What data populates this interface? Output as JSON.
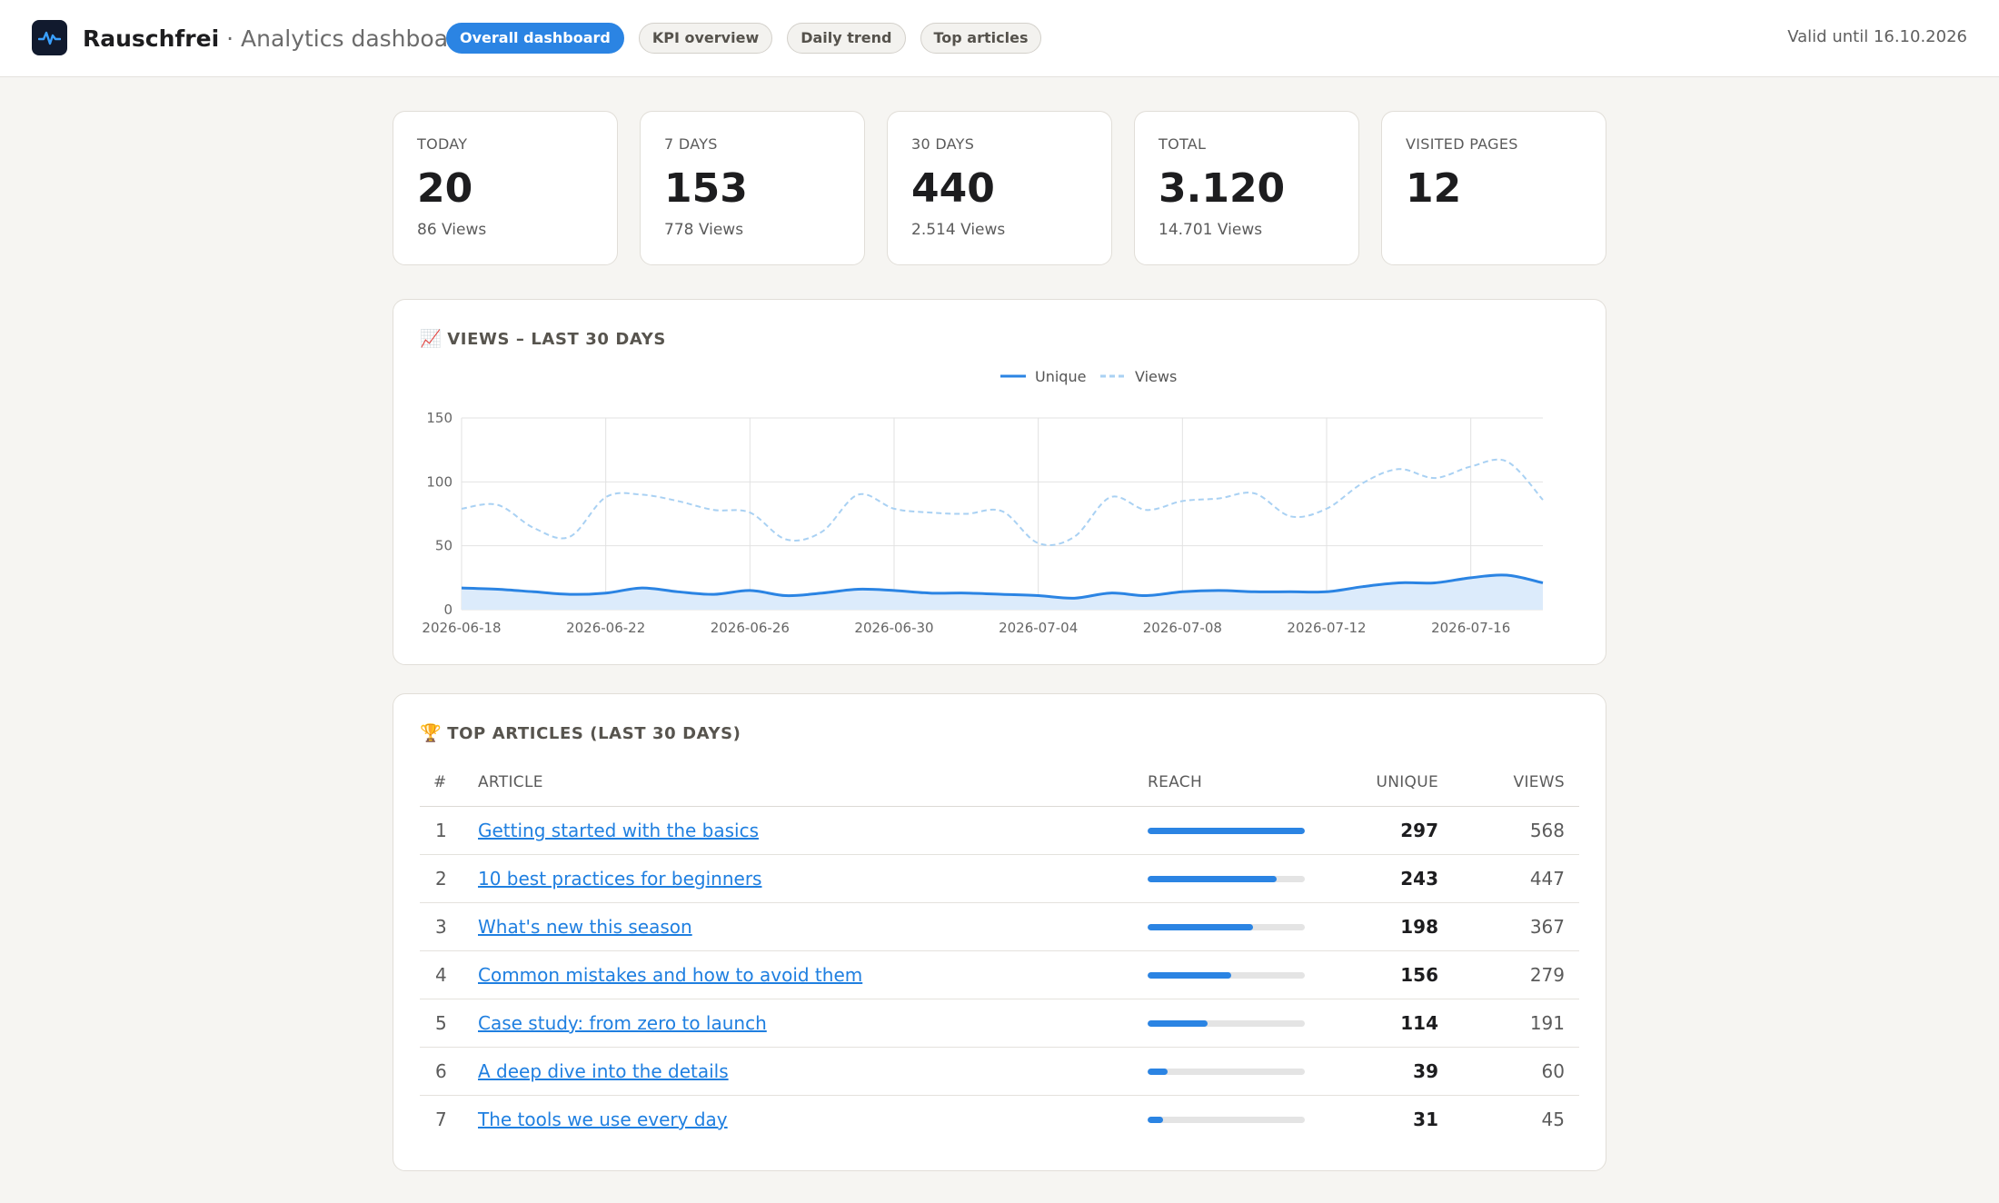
{
  "header": {
    "brand_name": "Rauschfrei",
    "separator": " · ",
    "subtitle": "Analytics dashboard",
    "nav": [
      {
        "label": "Overall dashboard",
        "active": true
      },
      {
        "label": "KPI overview",
        "active": false
      },
      {
        "label": "Daily trend",
        "active": false
      },
      {
        "label": "Top articles",
        "active": false
      }
    ],
    "valid_until": "Valid until 16.10.2026",
    "logo_icon": "pulse-icon"
  },
  "kpis": [
    {
      "label": "TODAY",
      "value": "20",
      "sub": "86 Views"
    },
    {
      "label": "7 DAYS",
      "value": "153",
      "sub": "778 Views"
    },
    {
      "label": "30 DAYS",
      "value": "440",
      "sub": "2.514 Views"
    },
    {
      "label": "TOTAL",
      "value": "3.120",
      "sub": "14.701 Views"
    },
    {
      "label": "VISITED PAGES",
      "value": "12",
      "sub": ""
    }
  ],
  "chart": {
    "emoji": "📈",
    "title": "VIEWS – LAST 30 DAYS"
  },
  "chart_data": {
    "type": "line",
    "x": [
      "2026-06-18",
      "2026-06-19",
      "2026-06-20",
      "2026-06-21",
      "2026-06-22",
      "2026-06-23",
      "2026-06-24",
      "2026-06-25",
      "2026-06-26",
      "2026-06-27",
      "2026-06-28",
      "2026-06-29",
      "2026-06-30",
      "2026-07-01",
      "2026-07-02",
      "2026-07-03",
      "2026-07-04",
      "2026-07-05",
      "2026-07-06",
      "2026-07-07",
      "2026-07-08",
      "2026-07-09",
      "2026-07-10",
      "2026-07-11",
      "2026-07-12",
      "2026-07-13",
      "2026-07-14",
      "2026-07-15",
      "2026-07-16",
      "2026-07-17",
      "2026-07-18"
    ],
    "xticks": [
      "2026-06-18",
      "2026-06-22",
      "2026-06-26",
      "2026-06-30",
      "2026-07-04",
      "2026-07-08",
      "2026-07-12",
      "2026-07-16"
    ],
    "series": [
      {
        "name": "Unique",
        "color": "#2b84e3",
        "style": "solid",
        "fill": true,
        "values": [
          17,
          16,
          14,
          12,
          13,
          17,
          14,
          12,
          15,
          11,
          13,
          16,
          15,
          13,
          13,
          12,
          11,
          9,
          13,
          11,
          14,
          15,
          14,
          14,
          14,
          18,
          21,
          21,
          25,
          27,
          21
        ]
      },
      {
        "name": "Views",
        "color": "#a9d1f3",
        "style": "dashed",
        "fill": false,
        "values": [
          79,
          82,
          64,
          57,
          88,
          90,
          85,
          78,
          76,
          55,
          61,
          90,
          79,
          76,
          75,
          77,
          52,
          57,
          88,
          78,
          85,
          87,
          91,
          73,
          79,
          99,
          110,
          103,
          112,
          116,
          86
        ]
      }
    ],
    "ylim": [
      0,
      150
    ],
    "yticks": [
      0,
      50,
      100,
      150
    ],
    "xlabel": "",
    "ylabel": "",
    "grid": true,
    "legend": "top-center"
  },
  "articles": {
    "emoji": "🏆",
    "title": "TOP ARTICLES (LAST 30 DAYS)",
    "headers": {
      "num": "#",
      "article": "ARTICLE",
      "reach": "REACH",
      "unique": "UNIQUE",
      "views": "VIEWS"
    },
    "rows": [
      {
        "rank": "1",
        "title": "Getting started with the basics",
        "reach": 1.0,
        "unique": "297",
        "views": "568"
      },
      {
        "rank": "2",
        "title": "10 best practices for beginners",
        "reach": 0.82,
        "unique": "243",
        "views": "447"
      },
      {
        "rank": "3",
        "title": "What's new this season",
        "reach": 0.67,
        "unique": "198",
        "views": "367"
      },
      {
        "rank": "4",
        "title": "Common mistakes and how to avoid them",
        "reach": 0.53,
        "unique": "156",
        "views": "279"
      },
      {
        "rank": "5",
        "title": "Case study: from zero to launch",
        "reach": 0.38,
        "unique": "114",
        "views": "191"
      },
      {
        "rank": "6",
        "title": "A deep dive into the details",
        "reach": 0.13,
        "unique": "39",
        "views": "60"
      },
      {
        "rank": "7",
        "title": "The tools we use every day",
        "reach": 0.1,
        "unique": "31",
        "views": "45"
      }
    ]
  }
}
